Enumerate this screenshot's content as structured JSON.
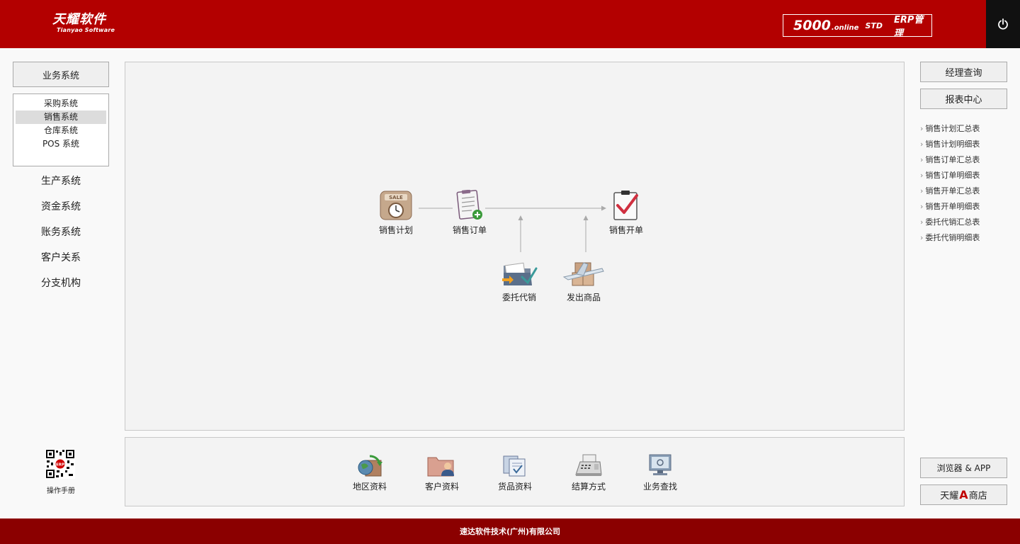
{
  "header": {
    "logo_cn": "天耀软件",
    "logo_en": "Tianyao Software",
    "version_main": "5000",
    "version_sub": ".online",
    "version_std": "STD",
    "version_erp": "ERP管理",
    "power_icon": "power-icon",
    "brand_color": "#b30000"
  },
  "sidebar": {
    "business_label": "业务系统",
    "sub_items": [
      {
        "label": "采购系统"
      },
      {
        "label": "销售系统",
        "active": true
      },
      {
        "label": "仓库系统"
      },
      {
        "label": "POS 系统"
      }
    ],
    "items": [
      {
        "label": "生产系统"
      },
      {
        "label": "资金系统"
      },
      {
        "label": "账务系统"
      },
      {
        "label": "客户关系"
      },
      {
        "label": "分支机构"
      }
    ],
    "manual_label": "操作手册",
    "qr_badge": "ERP"
  },
  "flow": {
    "nodes": [
      {
        "label": "销售计划",
        "icon": "sale-clock-icon"
      },
      {
        "label": "销售订单",
        "icon": "order-clipboard-icon"
      },
      {
        "label": "销售开单",
        "icon": "invoice-check-icon"
      },
      {
        "label": "委托代销",
        "icon": "consign-folder-icon"
      },
      {
        "label": "发出商品",
        "icon": "ship-goods-icon"
      }
    ],
    "sale_tag": "SALE"
  },
  "tools": [
    {
      "label": "地区资料",
      "icon": "region-globe-icon"
    },
    {
      "label": "客户资料",
      "icon": "customer-folder-icon"
    },
    {
      "label": "货品资料",
      "icon": "goods-docs-icon"
    },
    {
      "label": "结算方式",
      "icon": "cash-register-icon"
    },
    {
      "label": "业务查找",
      "icon": "search-monitor-icon"
    }
  ],
  "right": {
    "manager_query": "经理查询",
    "report_center": "报表中心",
    "reports": [
      {
        "label": "销售计划汇总表"
      },
      {
        "label": "销售计划明细表"
      },
      {
        "label": "销售订单汇总表"
      },
      {
        "label": "销售订单明细表"
      },
      {
        "label": "销售开单汇总表"
      },
      {
        "label": "销售开单明细表"
      },
      {
        "label": "委托代销汇总表"
      },
      {
        "label": "委托代销明细表"
      }
    ],
    "browser_app": "浏览器 & APP",
    "shop_prefix": "天耀",
    "shop_mark": "A",
    "shop_suffix": "商店"
  },
  "footer": {
    "text": "速达软件技术(广州)有限公司"
  }
}
